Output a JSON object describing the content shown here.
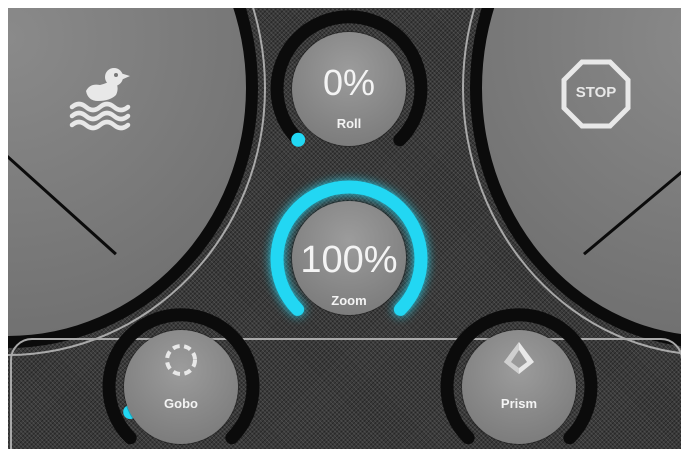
{
  "left_panel": {
    "icon": "duck-swim-icon"
  },
  "right_panel": {
    "icon": "stop-sign-icon",
    "label": "STOP"
  },
  "colors": {
    "accent": "#21d7f3",
    "ring_track": "#0b0b0b",
    "knob_face": "#888888"
  },
  "knobs": {
    "roll": {
      "value": "0%",
      "label": "Roll"
    },
    "zoom": {
      "value": "100%",
      "label": "Zoom"
    },
    "gobo": {
      "label": "Gobo",
      "icon": "gobo-wheel-icon"
    },
    "prism": {
      "label": "Prism",
      "icon": "prism-icon"
    }
  }
}
